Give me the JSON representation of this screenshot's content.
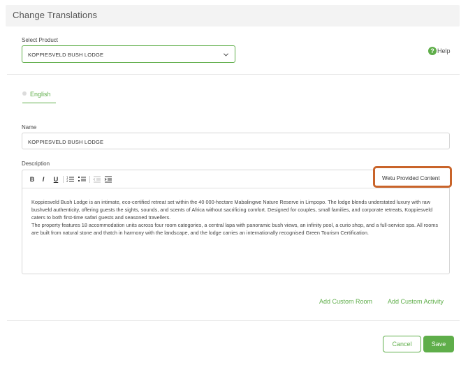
{
  "header": {
    "title": "Change Translations"
  },
  "product": {
    "label": "Select Product",
    "selected": "KOPPIESVELD BUSH LODGE"
  },
  "help": {
    "label": "Help"
  },
  "tabs": [
    {
      "label": "English"
    }
  ],
  "name_field": {
    "label": "Name",
    "value": "KOPPIESVELD BUSH LODGE"
  },
  "description": {
    "label": "Description",
    "toolbar": {
      "bold": "B",
      "italic": "I",
      "underline": "U"
    },
    "wetu_button": "Wetu Provided Content",
    "paragraphs": [
      "Koppiesveld Bush Lodge is an intimate, eco-certified retreat set within the 40 000-hectare Mabalingwe Nature Reserve in Limpopo. The lodge blends understated luxury with raw bushveld authenticity, offering guests the sights, sounds, and scents of Africa without sacrificing comfort. Designed for couples, small families, and corporate retreats, Koppiesveld caters to both first-time safari guests and seasoned travellers.",
      "The property features 18 accommodation units across four room categories, a central lapa with panoramic bush views, an infinity pool, a curio shop, and a full-service spa. All rooms are built from natural stone and thatch in harmony with the landscape, and the lodge carries an internationally recognised Green Tourism Certification."
    ]
  },
  "actions": {
    "add_custom_room": "Add Custom Room",
    "add_custom_activity": "Add Custom Activity",
    "cancel": "Cancel",
    "save": "Save"
  },
  "colors": {
    "accent": "#5fae4a",
    "highlight_border": "#c9642a"
  }
}
